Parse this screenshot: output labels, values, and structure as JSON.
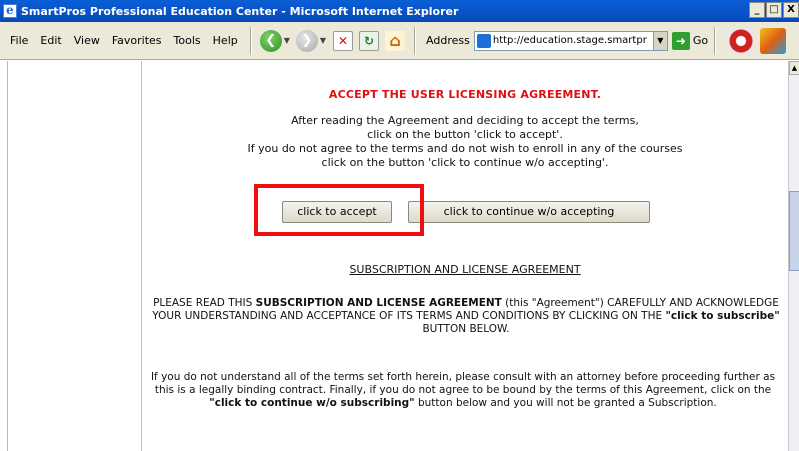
{
  "window": {
    "title": "SmartPros Professional Education Center - Microsoft Internet Explorer",
    "controls": [
      "_",
      "□",
      "X"
    ]
  },
  "menu": [
    "File",
    "Edit",
    "View",
    "Favorites",
    "Tools",
    "Help"
  ],
  "toolbar": {
    "address_label": "Address",
    "address_value": "http://education.stage.smartpr",
    "go_label": "Go"
  },
  "page": {
    "heading": "ACCEPT THE USER LICENSING AGREEMENT.",
    "instructions": [
      "After reading the Agreement and deciding to accept the terms,",
      "click on the button 'click to accept'.",
      "If you do not agree to the terms and do not wish to enroll in any of the courses",
      "click on the button 'click to continue w/o accepting'."
    ],
    "accept_button": "click to accept",
    "continue_button": "click to continue w/o accepting",
    "agreement_title": "SUBSCRIPTION AND LICENSE AGREEMENT",
    "para1": {
      "pre": "PLEASE READ THIS ",
      "bold1": "SUBSCRIPTION AND LICENSE AGREEMENT",
      "mid": " (this \"Agreement\") CAREFULLY AND ACKNOWLEDGE YOUR UNDERSTANDING AND ACCEPTANCE OF ITS TERMS AND CONDITIONS BY CLICKING ON THE ",
      "bold2": "\"click to subscribe\"",
      "post": " BUTTON BELOW."
    },
    "para2": {
      "pre": "If you do not understand all of the terms set forth herein, please consult with an attorney before proceeding further as this is a legally binding contract. Finally, if you do not agree to be bound by the terms of this Agreement, click on the ",
      "bold": "\"click to continue w/o subscribing\"",
      "post": " button below and you will not be granted a Subscription."
    }
  }
}
